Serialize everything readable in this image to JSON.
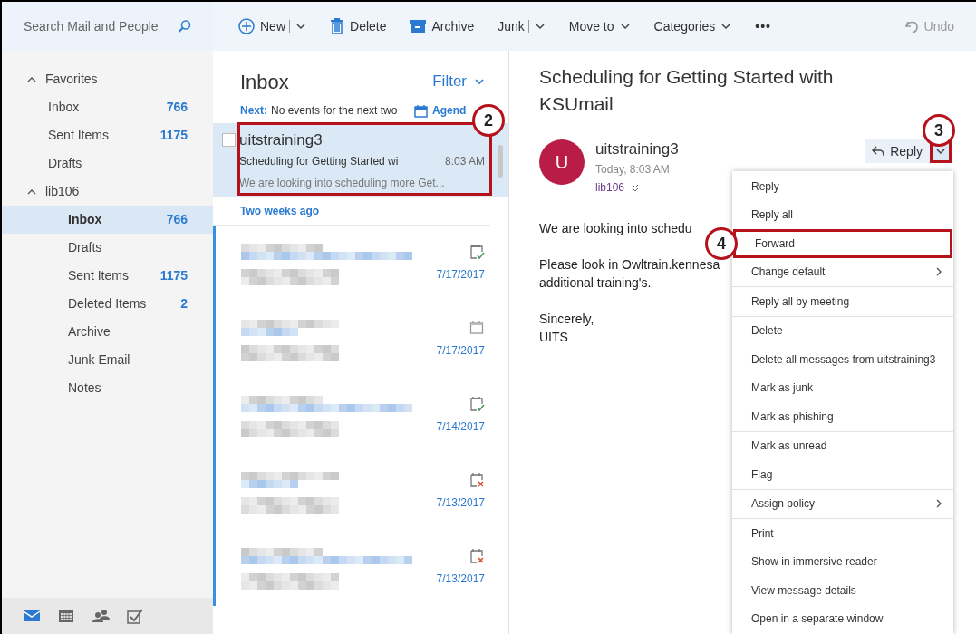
{
  "search": {
    "placeholder": "Search Mail and People"
  },
  "toolbar": [
    {
      "kind": "new",
      "label": "New"
    },
    {
      "kind": "delete",
      "label": "Delete"
    },
    {
      "kind": "archive",
      "label": "Archive"
    },
    {
      "kind": "split",
      "label": "Junk"
    },
    {
      "kind": "dropdown",
      "label": "Move to"
    },
    {
      "kind": "dropdown",
      "label": "Categories"
    },
    {
      "kind": "more",
      "label": "•••"
    }
  ],
  "undo": {
    "label": "Undo",
    "disabled": true
  },
  "folders": [
    {
      "label": "Favorites",
      "expanded": true,
      "children": [
        {
          "label": "Inbox",
          "count": "766",
          "selected": false
        },
        {
          "label": "Sent Items",
          "count": "1175",
          "selected": false
        },
        {
          "label": "Drafts",
          "selected": false
        }
      ]
    },
    {
      "label": "lib106",
      "expanded": true,
      "children": [
        {
          "label": "Inbox",
          "count": "766",
          "selected": true
        },
        {
          "label": "Drafts",
          "selected": false
        },
        {
          "label": "Sent Items",
          "count": "1175",
          "selected": false
        },
        {
          "label": "Deleted Items",
          "count": "2",
          "selected": false
        },
        {
          "label": "Archive",
          "selected": false
        },
        {
          "label": "Junk Email",
          "selected": false
        },
        {
          "label": "Notes",
          "selected": false
        }
      ]
    }
  ],
  "apps": [
    {
      "kind": "mail",
      "selected": true
    },
    {
      "kind": "calendar",
      "selected": false
    },
    {
      "kind": "people",
      "selected": false
    },
    {
      "kind": "tasks",
      "selected": false
    }
  ],
  "message_list": {
    "title": "Inbox",
    "filter": "Filter",
    "next_label": "Next:",
    "next_text": "No events for the next two",
    "agenda": "Agend",
    "selected_message": {
      "checked": false,
      "sender": "uitstraining3",
      "subject": "Scheduling for Getting Started wi",
      "time": "8:03 AM",
      "preview": "We are looking into scheduling more Get...",
      "callout": "2"
    },
    "group_header": "Two weeks ago",
    "messages": [
      {
        "date": "7/17/2017",
        "kind": "accepted",
        "unread": true
      },
      {
        "date": "7/17/2017",
        "kind": "plain",
        "unread": true
      },
      {
        "date": "7/14/2017",
        "kind": "accepted",
        "unread": true
      },
      {
        "date": "7/13/2017",
        "kind": "declined",
        "unread": true
      },
      {
        "date": "7/13/2017",
        "kind": "declined",
        "unread": true
      }
    ]
  },
  "reading_pane": {
    "subject": "Scheduling for Getting Started with KSUmail",
    "avatar": "U",
    "sender": "uitstraining3",
    "date": "Today, 8:03 AM",
    "to": "lib106",
    "reply": "Reply",
    "reply_dropdown_callout": "3",
    "body": [
      [
        "We are looking into schedu"
      ],
      [
        "Please look in Owltrain.kennesa",
        "additional training's."
      ],
      [
        "Sincerely,",
        "UITS"
      ]
    ]
  },
  "menu": [
    [
      {
        "label": "Reply"
      },
      {
        "label": "Reply all"
      },
      {
        "label": "Forward",
        "callout": "4"
      },
      {
        "label": "Change default",
        "submenu": true
      }
    ],
    [
      {
        "label": "Reply all by meeting"
      }
    ],
    [
      {
        "label": "Delete"
      },
      {
        "label": "Delete all messages from uitstraining3"
      },
      {
        "label": "Mark as junk"
      },
      {
        "label": "Mark as phishing"
      }
    ],
    [
      {
        "label": "Mark as unread"
      },
      {
        "label": "Flag"
      }
    ],
    [
      {
        "label": "Assign policy",
        "submenu": true
      }
    ],
    [
      {
        "label": "Print"
      },
      {
        "label": "Show in immersive reader"
      },
      {
        "label": "View message details"
      },
      {
        "label": "Open in a separate window"
      }
    ]
  ]
}
